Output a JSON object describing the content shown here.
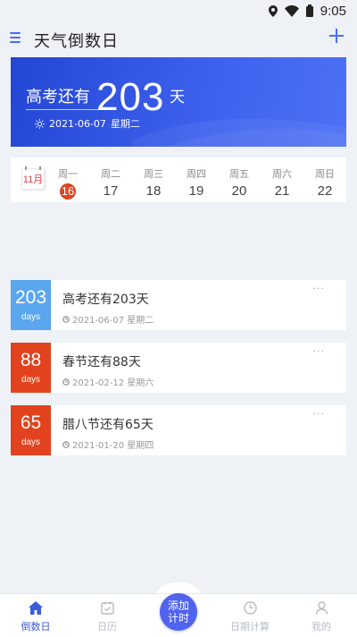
{
  "status_bar": {
    "time": "9:05"
  },
  "header": {
    "title": "天气倒数日"
  },
  "hero": {
    "label": "高考还有",
    "days": "203",
    "unit": "天",
    "date": "2021-06-07",
    "weekday": "星期二"
  },
  "calendar": {
    "month": "11月",
    "days": [
      {
        "name": "周一",
        "num": "16",
        "today": true
      },
      {
        "name": "周二",
        "num": "17",
        "today": false
      },
      {
        "name": "周三",
        "num": "18",
        "today": false
      },
      {
        "name": "周四",
        "num": "19",
        "today": false
      },
      {
        "name": "周五",
        "num": "20",
        "today": false
      },
      {
        "name": "周六",
        "num": "21",
        "today": false
      },
      {
        "name": "周日",
        "num": "22",
        "today": false
      }
    ]
  },
  "countdowns": [
    {
      "days": "203",
      "unit": "days",
      "title": "高考还有203天",
      "date": "2021-06-07 星期二",
      "color": "#5aa6ef"
    },
    {
      "days": "88",
      "unit": "days",
      "title": "春节还有88天",
      "date": "2021-02-12 星期六",
      "color": "#e2431e"
    },
    {
      "days": "65",
      "unit": "days",
      "title": "腊八节还有65天",
      "date": "2021-01-20 星期四",
      "color": "#e2431e"
    }
  ],
  "nav": {
    "items": [
      {
        "label": "倒数日",
        "icon": "home-icon",
        "active": true
      },
      {
        "label": "日历",
        "icon": "calendar-icon",
        "active": false
      },
      {
        "label": "日期计算",
        "icon": "clock-icon",
        "active": false
      },
      {
        "label": "我的",
        "icon": "user-icon",
        "active": false
      }
    ],
    "center_label_line1": "添加",
    "center_label_line2": "计时"
  },
  "colors": {
    "accent": "#3b5bdb",
    "hero_blue": "#2d4fe0",
    "today_red": "#e0431f"
  }
}
